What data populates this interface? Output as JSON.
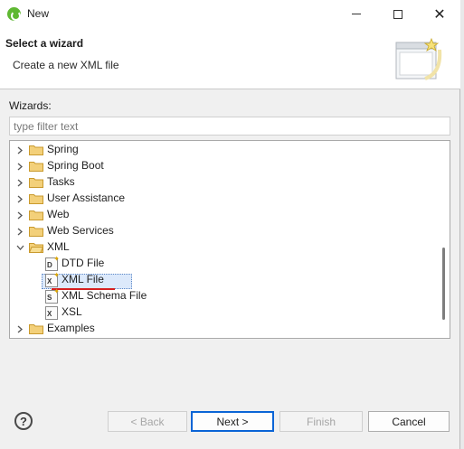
{
  "window": {
    "title": "New"
  },
  "header": {
    "title": "Select a wizard",
    "description": "Create a new XML file"
  },
  "filter": {
    "label": "Wizards:",
    "placeholder": "type filter text",
    "value": ""
  },
  "tree": {
    "items": [
      {
        "label": "Spring",
        "type": "folder",
        "expanded": false
      },
      {
        "label": "Spring Boot",
        "type": "folder",
        "expanded": false
      },
      {
        "label": "Tasks",
        "type": "folder",
        "expanded": false
      },
      {
        "label": "User Assistance",
        "type": "folder",
        "expanded": false
      },
      {
        "label": "Web",
        "type": "folder",
        "expanded": false
      },
      {
        "label": "Web Services",
        "type": "folder",
        "expanded": false
      },
      {
        "label": "XML",
        "type": "folder",
        "expanded": true
      },
      {
        "label": "DTD File",
        "type": "file",
        "icon_letter": "D"
      },
      {
        "label": "XML File",
        "type": "file",
        "icon_letter": "X",
        "selected": true
      },
      {
        "label": "XML Schema File",
        "type": "file",
        "icon_letter": "S"
      },
      {
        "label": "XSL",
        "type": "file",
        "icon_letter": "X"
      },
      {
        "label": "Examples",
        "type": "folder",
        "expanded": false
      }
    ]
  },
  "buttons": {
    "help": "?",
    "back": "< Back",
    "next": "Next >",
    "finish": "Finish",
    "cancel": "Cancel"
  },
  "colors": {
    "folder": "#e8b84a",
    "selection": "#dce9fb",
    "annotation_underline": "#d62020",
    "primary_border": "#0a64d6"
  }
}
